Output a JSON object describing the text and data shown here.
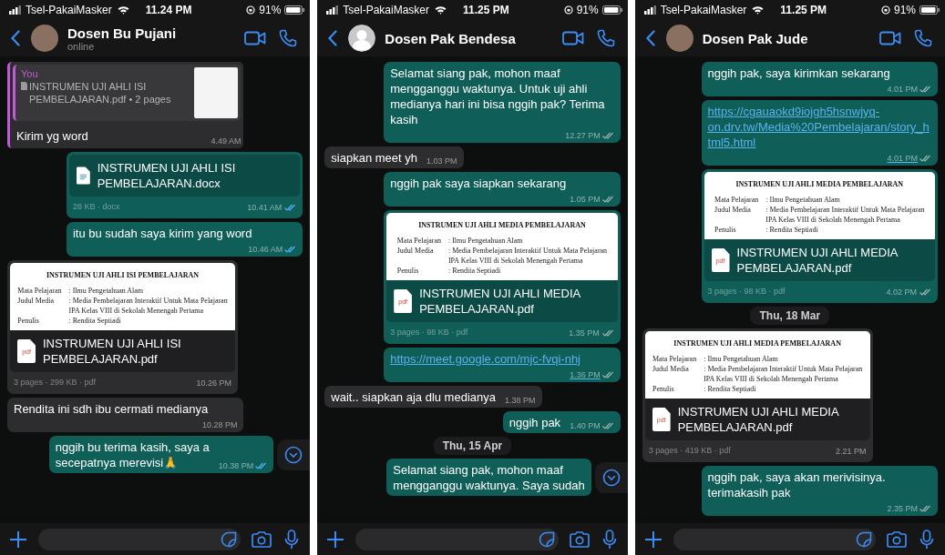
{
  "panels": [
    {
      "status_bar": {
        "carrier": "Tsel-PakaiMasker",
        "time": "11.24 PM",
        "battery": "91%"
      },
      "contact": {
        "name": "Dosen Bu Pujani",
        "status": "online",
        "has_photo": true
      },
      "scroll_down_button": true,
      "messages": [
        {
          "kind": "quote",
          "outgoing": false,
          "quote_sender": "You",
          "quote_text": "INSTRUMEN UJI AHLI ISI PEMBELAJARAN.pdf • 2 pages",
          "text": "Kirim yg word",
          "time": "4.49 AM"
        },
        {
          "kind": "docx",
          "outgoing": true,
          "name": "INSTRUMEN UJI AHLI ISI PEMBELAJARAN.docx",
          "meta": "28 KB · docx",
          "time": "10.41 AM",
          "read": true
        },
        {
          "kind": "text",
          "outgoing": true,
          "text": "itu bu sudah saya kirim yang word",
          "time": "10.46 AM",
          "read": true
        },
        {
          "kind": "pdf",
          "outgoing": false,
          "icon_text": "pdf",
          "preview": {
            "title": "INSTRUMEN UJI AHLI ISI PEMBELAJARAN",
            "rows": [
              {
                "label": "Mata Pelajaran",
                "value": ": Ilmu Pengetahuan Alam"
              },
              {
                "label": "Judul Media",
                "value": ": Media Pembelajaran Interaktif Untuk Mata Pelajaran"
              },
              {
                "value": "IPA Kelas VIII di Sekolah Menengah Pertama"
              },
              {
                "label": "Penulis",
                "value": ": Rendita Septiadi"
              }
            ]
          },
          "name": "INSTRUMEN UJI AHLI ISI PEMBELAJARAN.pdf",
          "meta": "3 pages · 299 KB · pdf",
          "time": "10.26 PM"
        },
        {
          "kind": "text",
          "outgoing": false,
          "text": "Rendita ini sdh ibu cermati medianya",
          "time": "10.28 PM"
        },
        {
          "kind": "text",
          "outgoing": true,
          "text": "nggih bu terima kasih, saya a\nsecepatnya merevisi🙏",
          "time": "10.38 PM",
          "read": true
        }
      ]
    },
    {
      "status_bar": {
        "carrier": "Tsel-PakaiMasker",
        "time": "11.25 PM",
        "battery": "91%"
      },
      "contact": {
        "name": "Dosen Pak Bendesa",
        "has_photo": false
      },
      "scroll_down_button": true,
      "messages": [
        {
          "kind": "text",
          "outgoing": true,
          "text": "Selamat siang pak, mohon maaf mengganggu waktunya. Untuk uji ahli medianya hari ini bisa nggih pak? Terima kasih",
          "time": "12.27 PM",
          "read": false
        },
        {
          "kind": "text",
          "outgoing": false,
          "text": "siapkan meet yh",
          "time": "1.03 PM"
        },
        {
          "kind": "text",
          "outgoing": true,
          "text": "nggih pak saya siapkan sekarang",
          "time": "1.05 PM",
          "read": false
        },
        {
          "kind": "pdf",
          "outgoing": true,
          "icon_text": "pdf",
          "preview": {
            "title": "INSTRUMEN UJI AHLI MEDIA PEMBELAJARAN",
            "rows": [
              {
                "label": "Mata Pelajaran",
                "value": ": Ilmu Pengetahuan Alam"
              },
              {
                "label": "Judul Media",
                "value": ": Media Pembelajaran Interaktif Untuk Mata Pelajaran"
              },
              {
                "value": "IPA Kelas VIII di Sekolah Menengah Pertama"
              },
              {
                "label": "Penulis",
                "value": ": Rendita Septiadi"
              }
            ]
          },
          "name": "INSTRUMEN UJI AHLI MEDIA PEMBELAJARAN.pdf",
          "meta": "3 pages · 98 KB · pdf",
          "time": "1.35 PM",
          "read": false
        },
        {
          "kind": "link",
          "outgoing": true,
          "text": "https://meet.google.com/mjc-fvqi-nhj",
          "time": "1.36 PM",
          "read": false
        },
        {
          "kind": "text",
          "outgoing": false,
          "text": "wait.. siapkan aja dlu medianya",
          "time": "1.38 PM"
        },
        {
          "kind": "text",
          "outgoing": true,
          "text": "nggih pak",
          "time": "1.40 PM",
          "read": false
        },
        {
          "kind": "date",
          "text": "Thu, 15 Apr"
        },
        {
          "kind": "text",
          "outgoing": true,
          "text": "Selamat siang pak, mohon maaf\nmengganggu waktunya. Saya sudah"
        }
      ]
    },
    {
      "status_bar": {
        "carrier": "Tsel-PakaiMasker",
        "time": "11.25 PM",
        "battery": "91%"
      },
      "contact": {
        "name": "Dosen Pak Jude",
        "has_photo": true
      },
      "scroll_down_button": false,
      "messages": [
        {
          "kind": "text",
          "outgoing": true,
          "text": "nggih pak, saya kirimkan sekarang",
          "time": "4.01 PM",
          "read": false
        },
        {
          "kind": "link",
          "outgoing": true,
          "text": "https://cgauaokd9iojgh5hsnwjyq-on.drv.tw/Media%20Pembelajaran/story_html5.html",
          "time": "4.01 PM",
          "read": false
        },
        {
          "kind": "pdf",
          "outgoing": true,
          "icon_text": "pdf",
          "preview": {
            "title": "INSTRUMEN UJI AHLI MEDIA PEMBELAJARAN",
            "rows": [
              {
                "label": "Mata Pelajaran",
                "value": ": Ilmu Pengetahuan Alam"
              },
              {
                "label": "Judul Media",
                "value": ": Media Pembelajaran Interaktif Untuk Mata Pelajaran"
              },
              {
                "value": "IPA Kelas VIII di Sekolah Menengah Pertama"
              },
              {
                "label": "Penulis",
                "value": ": Rendita Septiadi"
              }
            ]
          },
          "name": "INSTRUMEN UJI AHLI MEDIA PEMBELAJARAN.pdf",
          "meta": "3 pages · 98 KB · pdf",
          "time": "4.02 PM",
          "read": false
        },
        {
          "kind": "date",
          "text": "Thu, 18 Mar"
        },
        {
          "kind": "pdf",
          "outgoing": false,
          "icon_text": "pdf",
          "preview": {
            "title": "INSTRUMEN UJI AHLI MEDIA PEMBELAJARAN",
            "rows": [
              {
                "label": "Mata Pelajaran",
                "value": ": Ilmu Pengetahuan Alam"
              },
              {
                "label": "Judul Media",
                "value": ": Media Pembelajaran Interaktif Untuk Mata Pelajaran"
              },
              {
                "value": "IPA Kelas VIII di Sekolah Menengah Pertama"
              },
              {
                "label": "Penulis",
                "value": ": Rendita Septiadi"
              }
            ]
          },
          "name": "INSTRUMEN UJI AHLI MEDIA PEMBELAJARAN.pdf",
          "meta": "3 pages · 419 KB · pdf",
          "time": "2.21 PM"
        },
        {
          "kind": "text",
          "outgoing": true,
          "text": "nggih pak, saya akan merivisinya. terimakasih pak",
          "time": "2.35 PM",
          "read": false
        }
      ]
    }
  ]
}
